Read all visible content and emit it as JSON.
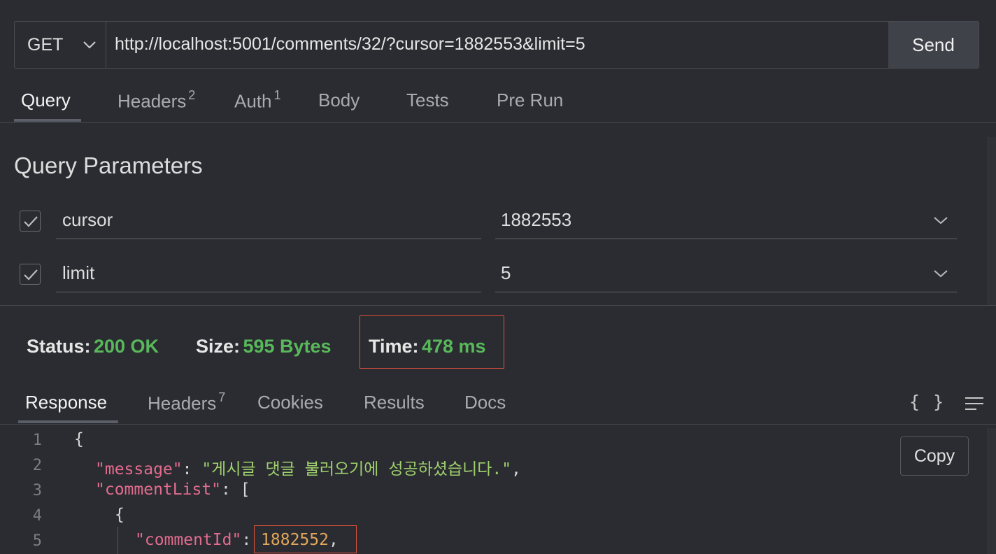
{
  "request": {
    "method": "GET",
    "url": "http://localhost:5001/comments/32/?cursor=1882553&limit=5",
    "send_label": "Send"
  },
  "request_tabs": {
    "query": "Query",
    "headers": "Headers",
    "headers_count": "2",
    "auth": "Auth",
    "auth_count": "1",
    "body": "Body",
    "tests": "Tests",
    "pre_run": "Pre Run"
  },
  "query_section": {
    "title": "Query Parameters",
    "params": [
      {
        "name": "cursor",
        "value": "1882553",
        "checked": true
      },
      {
        "name": "limit",
        "value": "5",
        "checked": true
      }
    ]
  },
  "status": {
    "status_label": "Status:",
    "status_value": "200 OK",
    "size_label": "Size:",
    "size_value": "595 Bytes",
    "time_label": "Time:",
    "time_value": "478 ms"
  },
  "response_tabs": {
    "response": "Response",
    "headers": "Headers",
    "headers_count": "7",
    "cookies": "Cookies",
    "results": "Results",
    "docs": "Docs"
  },
  "response_tools": {
    "format_icon_text": "{ }",
    "copy_label": "Copy"
  },
  "code_lines": {
    "l1": {
      "num": "1",
      "text": "{"
    },
    "l2": {
      "num": "2",
      "key": "\"message\"",
      "sep": ": ",
      "value": "\"게시글 댓글 불러오기에 성공하셨습니다.\"",
      "end": ","
    },
    "l3": {
      "num": "3",
      "key": "\"commentList\"",
      "sep": ": ",
      "end": "["
    },
    "l4": {
      "num": "4",
      "text": "{"
    },
    "l5": {
      "num": "5",
      "key": "\"commentId\"",
      "sep": ": ",
      "value": "1882552",
      "end": ","
    }
  },
  "colors": {
    "background": "#2a2c31",
    "status_green": "#58b85a",
    "highlight_red": "#e0533c",
    "json_key": "#e36c8e",
    "json_string": "#9fcf6d",
    "json_number": "#e1a75a"
  }
}
